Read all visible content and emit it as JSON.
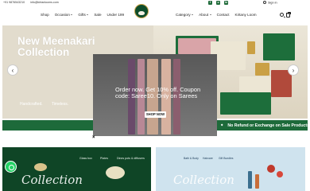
{
  "topbar": {
    "phone": "+91 9876543210",
    "email": "info@kirtanlooms.com",
    "social": [
      {
        "icon": "facebook-icon",
        "glyph": "f"
      },
      {
        "icon": "instagram-icon",
        "glyph": "o"
      },
      {
        "icon": "linkedin-icon",
        "glyph": "in"
      }
    ],
    "signin_label": "Sign in"
  },
  "nav": {
    "left": [
      {
        "label": "Shop"
      },
      {
        "label": "Occasion",
        "dropdown": true
      },
      {
        "label": "Gifts",
        "dropdown": true
      },
      {
        "label": "Sale"
      },
      {
        "label": "Under 199"
      }
    ],
    "right": [
      {
        "label": "Category",
        "dropdown": true
      },
      {
        "label": "About",
        "dropdown": true
      },
      {
        "label": "Contact"
      },
      {
        "label": "Kirtany Loom"
      }
    ]
  },
  "hero": {
    "title": "New Meenakari Collection",
    "tagline_1": "Handcrafted.",
    "tagline_2": "Timeless."
  },
  "popup": {
    "message": "Order now. Get 10% off. Coupon code: Saree10. Only on Sarees",
    "button_label": "SHOP NOW",
    "close_glyph": "×"
  },
  "strip": {
    "text": "No Refund or Exchange on Sale Products"
  },
  "banner_left": {
    "labels": [
      "Glass box",
      "Plates",
      "Dines pots & diffusers"
    ],
    "script": "Collection"
  },
  "banner_right": {
    "labels": [
      "Bath & Body",
      "Haircare",
      "Gift Bundles"
    ],
    "script": "Collection"
  },
  "colors": {
    "brand_green": "#1d6a3a",
    "popup_gray": "#6c6c6c",
    "whatsapp": "#25d366"
  }
}
